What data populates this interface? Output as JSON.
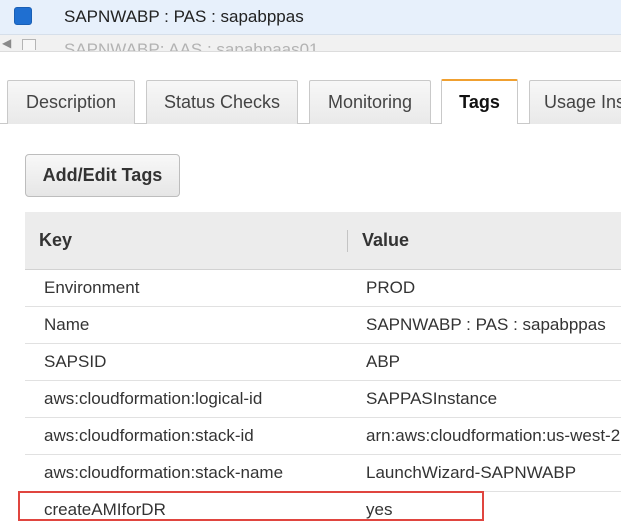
{
  "instances": {
    "selected": "SAPNWABP : PAS : sapabppas",
    "next": "SAPNWABP: AAS : sapabpaas01"
  },
  "tabs": [
    {
      "label": "Description"
    },
    {
      "label": "Status Checks"
    },
    {
      "label": "Monitoring"
    },
    {
      "label": "Tags",
      "active": true
    },
    {
      "label": "Usage Ins"
    }
  ],
  "actions": {
    "add_edit_tags": "Add/Edit Tags"
  },
  "tags_table": {
    "headers": {
      "key": "Key",
      "value": "Value"
    },
    "rows": [
      {
        "key": "Environment",
        "value": "PROD"
      },
      {
        "key": "Name",
        "value": "SAPNWABP : PAS : sapabppas"
      },
      {
        "key": "SAPSID",
        "value": "ABP"
      },
      {
        "key": "aws:cloudformation:logical-id",
        "value": "SAPPASInstance"
      },
      {
        "key": "aws:cloudformation:stack-id",
        "value": "arn:aws:cloudformation:us-west-2"
      },
      {
        "key": "aws:cloudformation:stack-name",
        "value": "LaunchWizard-SAPNWABP"
      },
      {
        "key": "createAMIforDR",
        "value": "yes"
      }
    ]
  },
  "colors": {
    "highlight": "#e0453f",
    "active_tab_accent": "#f0a030",
    "selected_row_bg": "#e7f0fb"
  }
}
